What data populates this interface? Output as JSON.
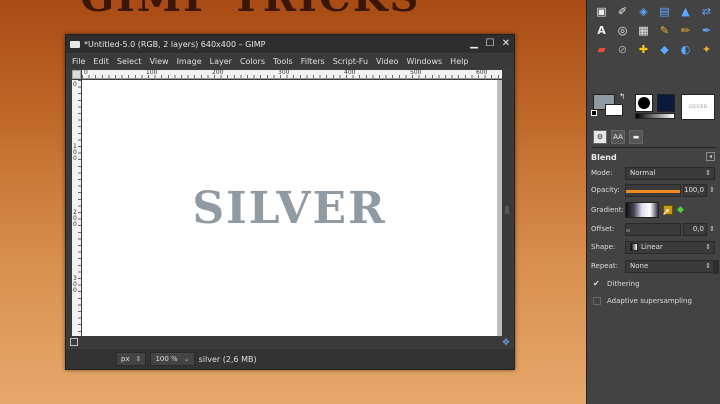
{
  "banner_text": "GIMP TRICKS",
  "window": {
    "title": "*Untitled-5.0 (RGB, 2 layers) 640x400 – GIMP",
    "controls": {
      "minimize": "▁",
      "maximize": "☐",
      "close": "✕"
    }
  },
  "menu": [
    "File",
    "Edit",
    "Select",
    "View",
    "Image",
    "Layer",
    "Colors",
    "Tools",
    "Filters",
    "Script-Fu",
    "Video",
    "Windows",
    "Help"
  ],
  "rulers": {
    "horizontal": [
      "0",
      "100",
      "200",
      "300",
      "400",
      "500",
      "600"
    ],
    "vertical": [
      "0",
      "100",
      "200",
      "300"
    ]
  },
  "canvas": {
    "text": "SILVER",
    "text_color": "#8f9aa3"
  },
  "status": {
    "unit": "px",
    "zoom": "100 %",
    "layer_info": "silver (2,6 MB)"
  },
  "toolbox": {
    "fg_color": "#8f9aa3",
    "bg_color": "#ffffff",
    "image_thumb_text": "SILVER",
    "tool_options": {
      "title": "Blend",
      "mode_label": "Mode:",
      "mode_value": "Normal",
      "opacity_label": "Opacity:",
      "opacity_value": "100,0",
      "opacity_fraction": 1.0,
      "gradient_label": "Gradient:",
      "offset_label": "Offset:",
      "offset_value": "0,0",
      "shape_label": "Shape:",
      "shape_value": "Linear",
      "repeat_label": "Repeat:",
      "repeat_value": "None",
      "dithering_label": "Dithering",
      "dithering_checked": true,
      "adaptive_label": "Adaptive supersampling",
      "adaptive_checked": false
    }
  },
  "icons": {
    "tools": [
      "rect-select-icon",
      "paintbrush-tool-icon",
      "transform-icon",
      "layers-stack-icon",
      "bucket-icon",
      "flip-icon",
      "text-tool-icon",
      "clone-icon",
      "blend-icon",
      "pencil-tool-icon",
      "eraser-icon",
      "airbrush-icon",
      "ink-icon",
      "heal-icon",
      "perspective-clone-icon",
      "dodge-icon",
      "smudge-icon",
      "color-picker-icon"
    ],
    "accent": "#f08a24"
  }
}
